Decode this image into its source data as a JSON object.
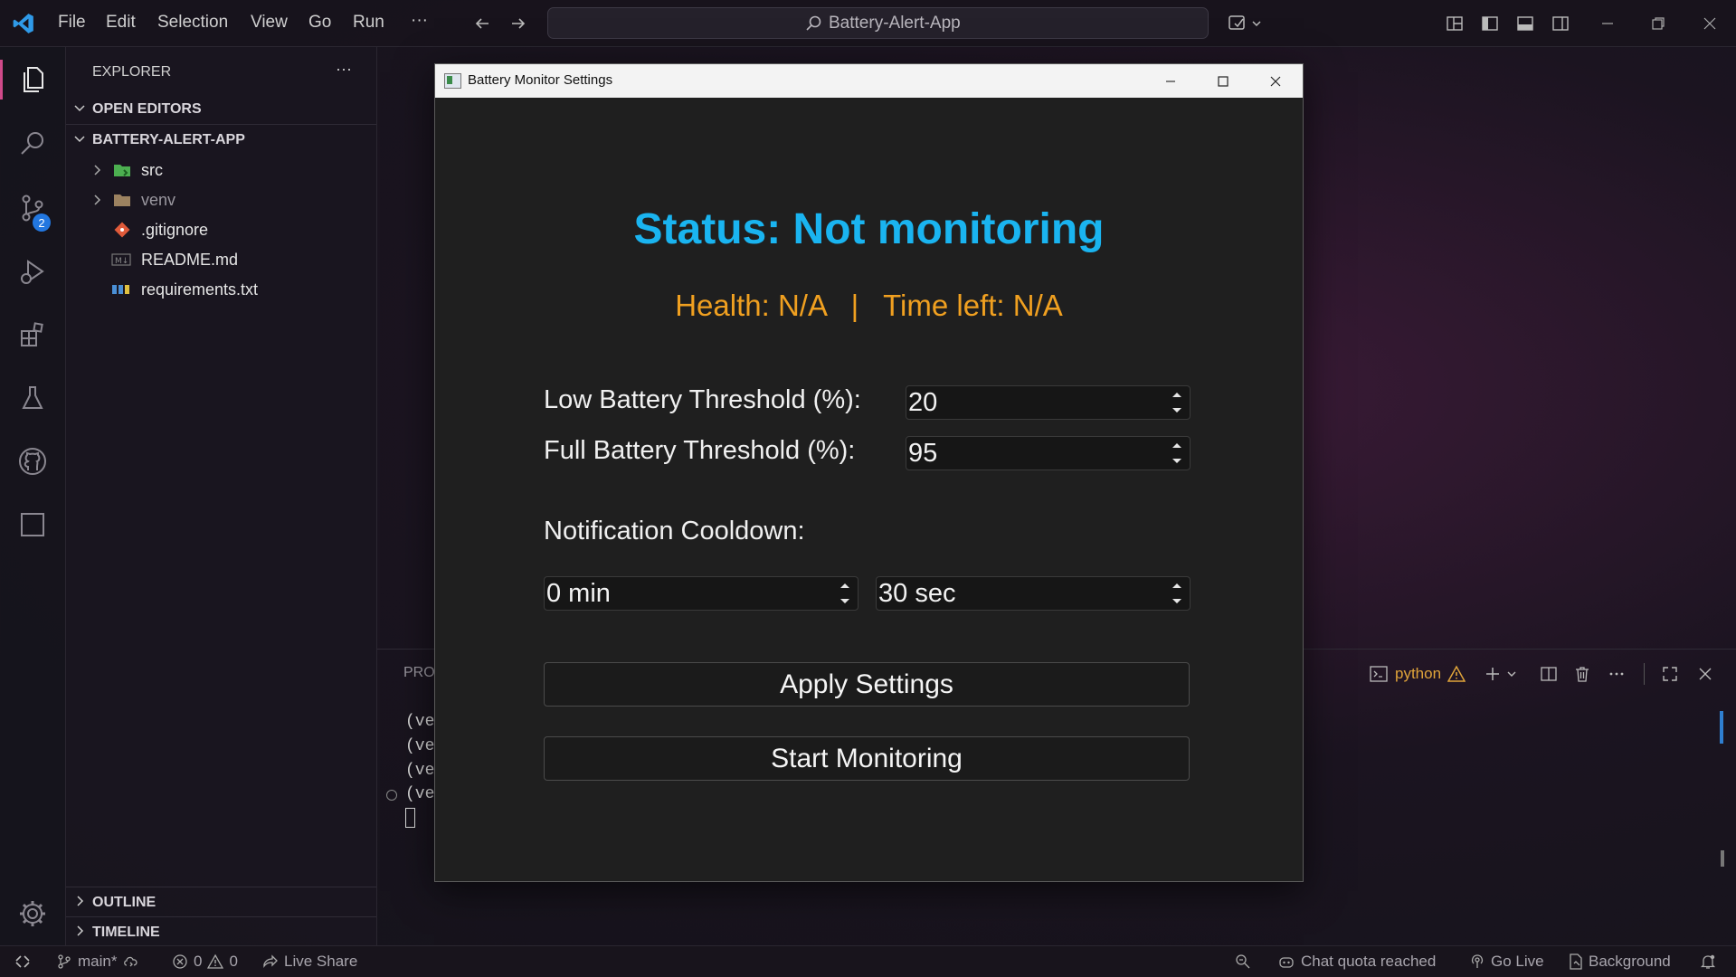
{
  "menu": {
    "file": "File",
    "edit": "Edit",
    "selection": "Selection",
    "view": "View",
    "go": "Go",
    "run": "Run",
    "more": "···"
  },
  "command_center": {
    "text": "Battery-Alert-App"
  },
  "activity": {
    "scm_badge": "2"
  },
  "explorer": {
    "title": "EXPLORER",
    "more": "···",
    "open_editors": "OPEN EDITORS",
    "project": "BATTERY-ALERT-APP",
    "items": [
      {
        "label": "src"
      },
      {
        "label": "venv"
      },
      {
        "label": ".gitignore"
      },
      {
        "label": "README.md"
      },
      {
        "label": "requirements.txt"
      }
    ],
    "outline": "OUTLINE",
    "timeline": "TIMELINE"
  },
  "panel": {
    "tab_partial": "PRO",
    "terminal_name": "python",
    "lines": [
      "(ve",
      "(ve",
      "(ve",
      "(ve"
    ]
  },
  "statusbar": {
    "branch": "main*",
    "errors": "0",
    "warnings": "0",
    "live_share": "Live Share",
    "chat": "Chat quota reached",
    "go_live": "Go Live",
    "background": "Background"
  },
  "dialog": {
    "title": "Battery Monitor Settings",
    "status": "Status: Not monitoring",
    "info": "Health: N/A   |   Time left: N/A",
    "low_label": "Low Battery Threshold (%):",
    "low_value": "20",
    "full_label": "Full Battery Threshold (%):",
    "full_value": "95",
    "cooldown_label": "Notification Cooldown:",
    "cooldown_min": "0 min",
    "cooldown_sec": "30 sec",
    "apply": "Apply Settings",
    "start": "Start Monitoring",
    "colors": {
      "status": "#1ab4f0",
      "info": "#f0a020"
    }
  }
}
